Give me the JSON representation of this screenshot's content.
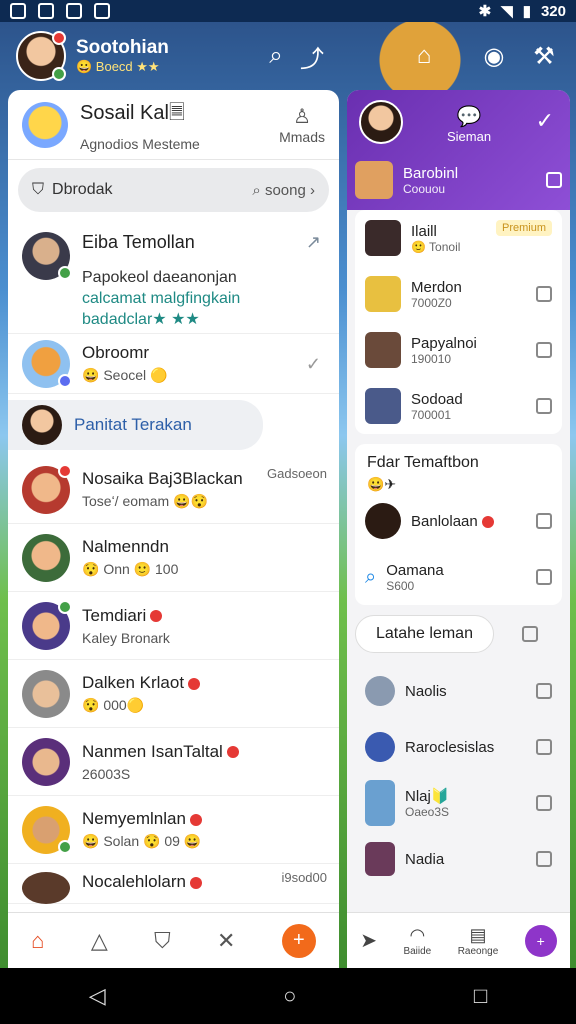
{
  "status_bar": {
    "time": "320"
  },
  "header": {
    "name": "Sootohian",
    "sub": "😀 Boecd ★★"
  },
  "left": {
    "title": "Sosail Kal🗏",
    "subtitle": "Agnodios Mesteme",
    "manage_label": "Mmads",
    "search": {
      "label": "Dbrodak",
      "right": "soong ›"
    },
    "feature": {
      "title": "Eiba Temollan",
      "line1": "Papokeol daeanonjan",
      "line2": "calcamat malgfingkain",
      "line3": "badadclar★ ★★"
    },
    "rows": [
      {
        "name": "Obroomr",
        "sub": "😀 Seocel 🟡"
      },
      {
        "name": "Panitat Terakan",
        "sub": ""
      },
      {
        "name": "Nosaika Baj3Blackan",
        "sub": "Toseʻ/ eomam 😀😯",
        "side": "Gadsoeon"
      },
      {
        "name": "Nalmenndn",
        "sub": "😯 Onn 🙂 100"
      },
      {
        "name": "Temdiari",
        "sub": "Kaley Bronark"
      },
      {
        "name": "Dalken Krlaot",
        "sub": "😯 000🟡"
      },
      {
        "name": "Nanmen IsanTaltal",
        "sub": "26003S"
      },
      {
        "name": "Nemyemlnlan",
        "sub": "😀 Solan 😯 09 😀"
      },
      {
        "name": "Nocalehlolarn",
        "sub": "",
        "side": "i9sod00"
      }
    ]
  },
  "right": {
    "chat_label": "Sieman",
    "top_item": {
      "name": "Barobinl",
      "sub": "Coouou"
    },
    "card_rows": [
      {
        "name": "Ilaill",
        "sub": "🙂 Tonoil",
        "badge": "Premium"
      },
      {
        "name": "Merdon",
        "sub": "7000Z0"
      },
      {
        "name": "Papyalnoi",
        "sub": "190010"
      },
      {
        "name": "Sodoad",
        "sub": "700001"
      }
    ],
    "friends_title": "Fdar Temaftbon",
    "friends_emoji": "😀✈",
    "friend_rows": [
      {
        "name": "Banlolaan",
        "sub": ""
      },
      {
        "name": "Oamana",
        "sub": "S600"
      }
    ],
    "pill_label": "Latahe leman",
    "list_rows": [
      {
        "name": "Naolis",
        "sub": ""
      },
      {
        "name": "Raroclesislas",
        "sub": ""
      },
      {
        "name": "Nlaj🔰",
        "sub": "Oaeo3S"
      },
      {
        "name": "Nadia",
        "sub": ""
      }
    ],
    "nav": {
      "item2": "Baiide",
      "item3": "Raeonge"
    }
  }
}
